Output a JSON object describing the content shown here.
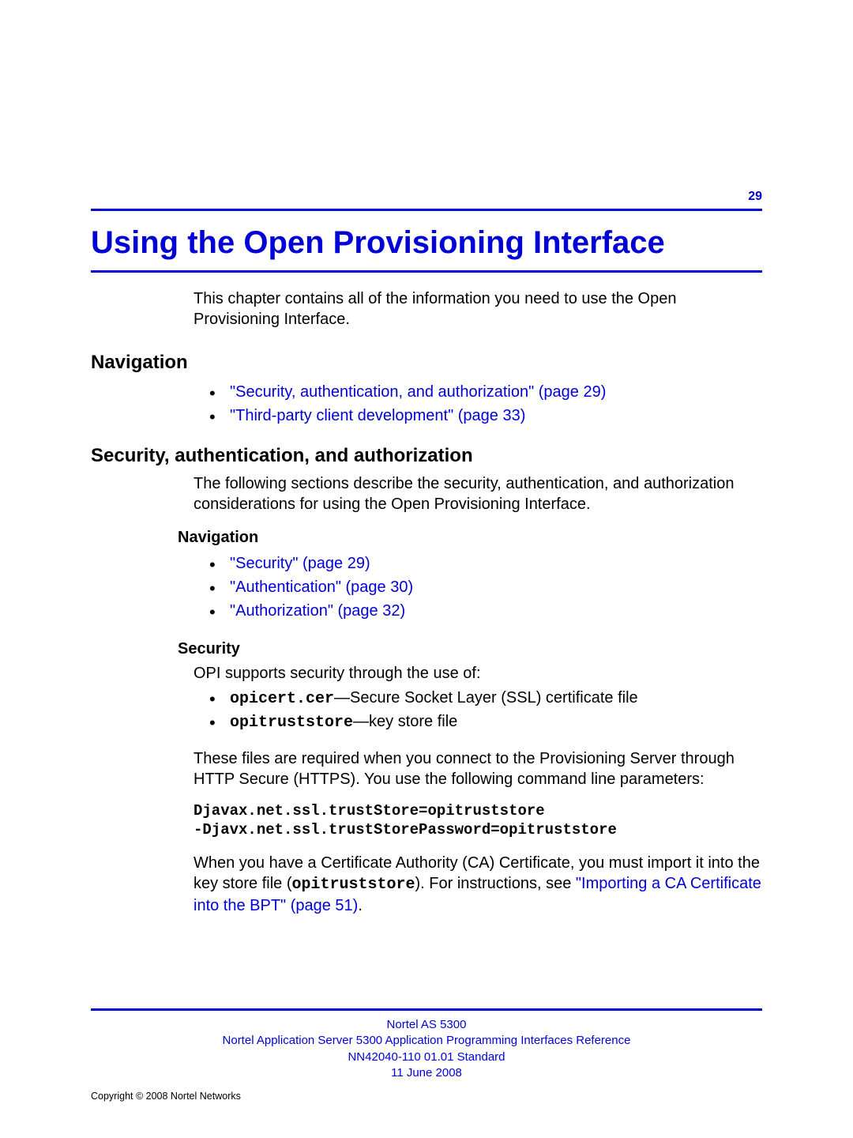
{
  "page_number": "29",
  "chapter_title": "Using the Open Provisioning Interface",
  "intro": "This chapter contains all of the information you need to use the Open Provisioning Interface.",
  "nav1": {
    "heading": "Navigation",
    "items": [
      "\"Security, authentication, and authorization\" (page 29)",
      "\"Third-party client development\" (page 33)"
    ]
  },
  "sec": {
    "heading": "Security, authentication, and authorization",
    "intro": "The following sections describe the security, authentication, and authorization considerations for using the Open Provisioning Interface."
  },
  "nav2": {
    "heading": "Navigation",
    "items": [
      "\"Security\" (page 29)",
      "\"Authentication\" (page 30)",
      "\"Authorization\" (page 32)"
    ]
  },
  "security": {
    "heading": "Security",
    "intro": "OPI supports security through the use of:",
    "items": {
      "a_code": "opicert.cer",
      "a_text": "—Secure Socket Layer (SSL) certificate file",
      "b_code": "opitruststore",
      "b_text": "—key store file"
    },
    "para2": "These files are required when you connect to the Provisioning Server through HTTP Secure (HTTPS). You use the following command line parameters:",
    "cmd1": "Djavax.net.ssl.trustStore=opitruststore",
    "cmd2": "-Djavx.net.ssl.trustStorePassword=opitruststore",
    "para3_a": "When you have a Certificate Authority (CA) Certificate, you must import it into the key store file (",
    "para3_code": "opitruststore",
    "para3_b": "). For instructions, see ",
    "para3_link": "\"Importing a CA Certificate into the BPT\" (page 51)",
    "para3_c": "."
  },
  "footer": {
    "l1": "Nortel AS 5300",
    "l2": "Nortel Application Server 5300 Application Programming Interfaces Reference",
    "l3": "NN42040-110   01.01   Standard",
    "l4": "11 June 2008"
  },
  "copyright": "Copyright © 2008 Nortel Networks"
}
